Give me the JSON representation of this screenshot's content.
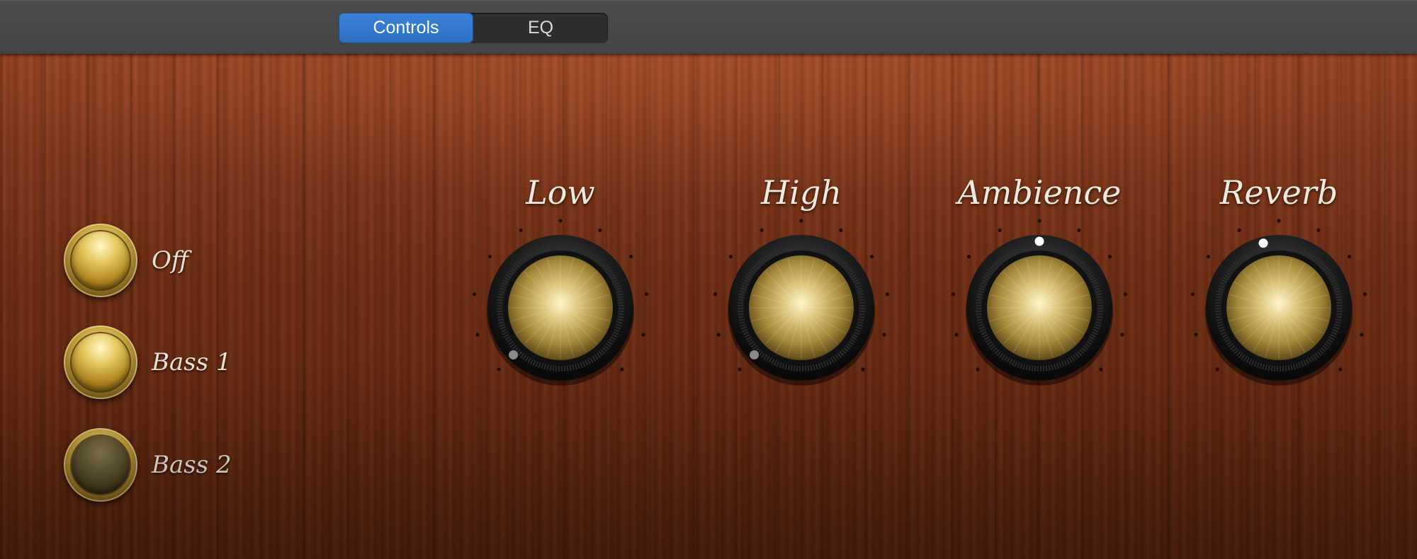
{
  "tabs": [
    {
      "label": "Controls",
      "active": true
    },
    {
      "label": "EQ",
      "active": false
    }
  ],
  "sound_buttons": [
    {
      "label": "Off",
      "state": "lit"
    },
    {
      "label": "Bass 1",
      "state": "lit"
    },
    {
      "label": "Bass 2",
      "state": "unlit"
    }
  ],
  "knobs": [
    {
      "label": "Low",
      "level": 0.0,
      "indicator_color": "#8a8a8a"
    },
    {
      "label": "High",
      "level": 0.0,
      "indicator_color": "#8a8a8a"
    },
    {
      "label": "Ambience",
      "level": 0.5,
      "indicator_color": "#ffffff"
    },
    {
      "label": "Reverb",
      "level": 0.45,
      "indicator_color": "#ffffff"
    }
  ],
  "colors": {
    "accent": "#2d6fc2",
    "wood": "#6e2d14",
    "gold": "#c9a742"
  },
  "icons": [
    "toggle-button-icon",
    "rotary-knob-icon"
  ]
}
